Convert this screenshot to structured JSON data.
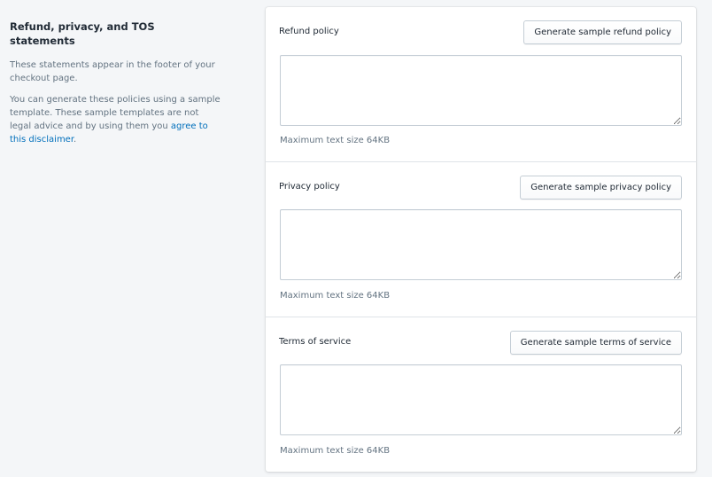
{
  "section": {
    "title": "Refund, privacy, and TOS statements",
    "desc1": "These statements appear in the footer of your checkout page.",
    "desc2_prefix": "You can generate these policies using a sample template. These sample templates are not legal advice and by using them you ",
    "desc2_link": "agree to this disclaimer",
    "desc2_suffix": "."
  },
  "policies": [
    {
      "label": "Refund policy",
      "button": "Generate sample refund policy",
      "value": "",
      "help": "Maximum text size 64KB"
    },
    {
      "label": "Privacy policy",
      "button": "Generate sample privacy policy",
      "value": "",
      "help": "Maximum text size 64KB"
    },
    {
      "label": "Terms of service",
      "button": "Generate sample terms of service",
      "value": "",
      "help": "Maximum text size 64KB"
    }
  ],
  "colors": {
    "background": "#f4f6f8",
    "card": "#ffffff",
    "link": "#006fbb",
    "subdued_text": "#637381",
    "border": "#c4cdd5"
  }
}
